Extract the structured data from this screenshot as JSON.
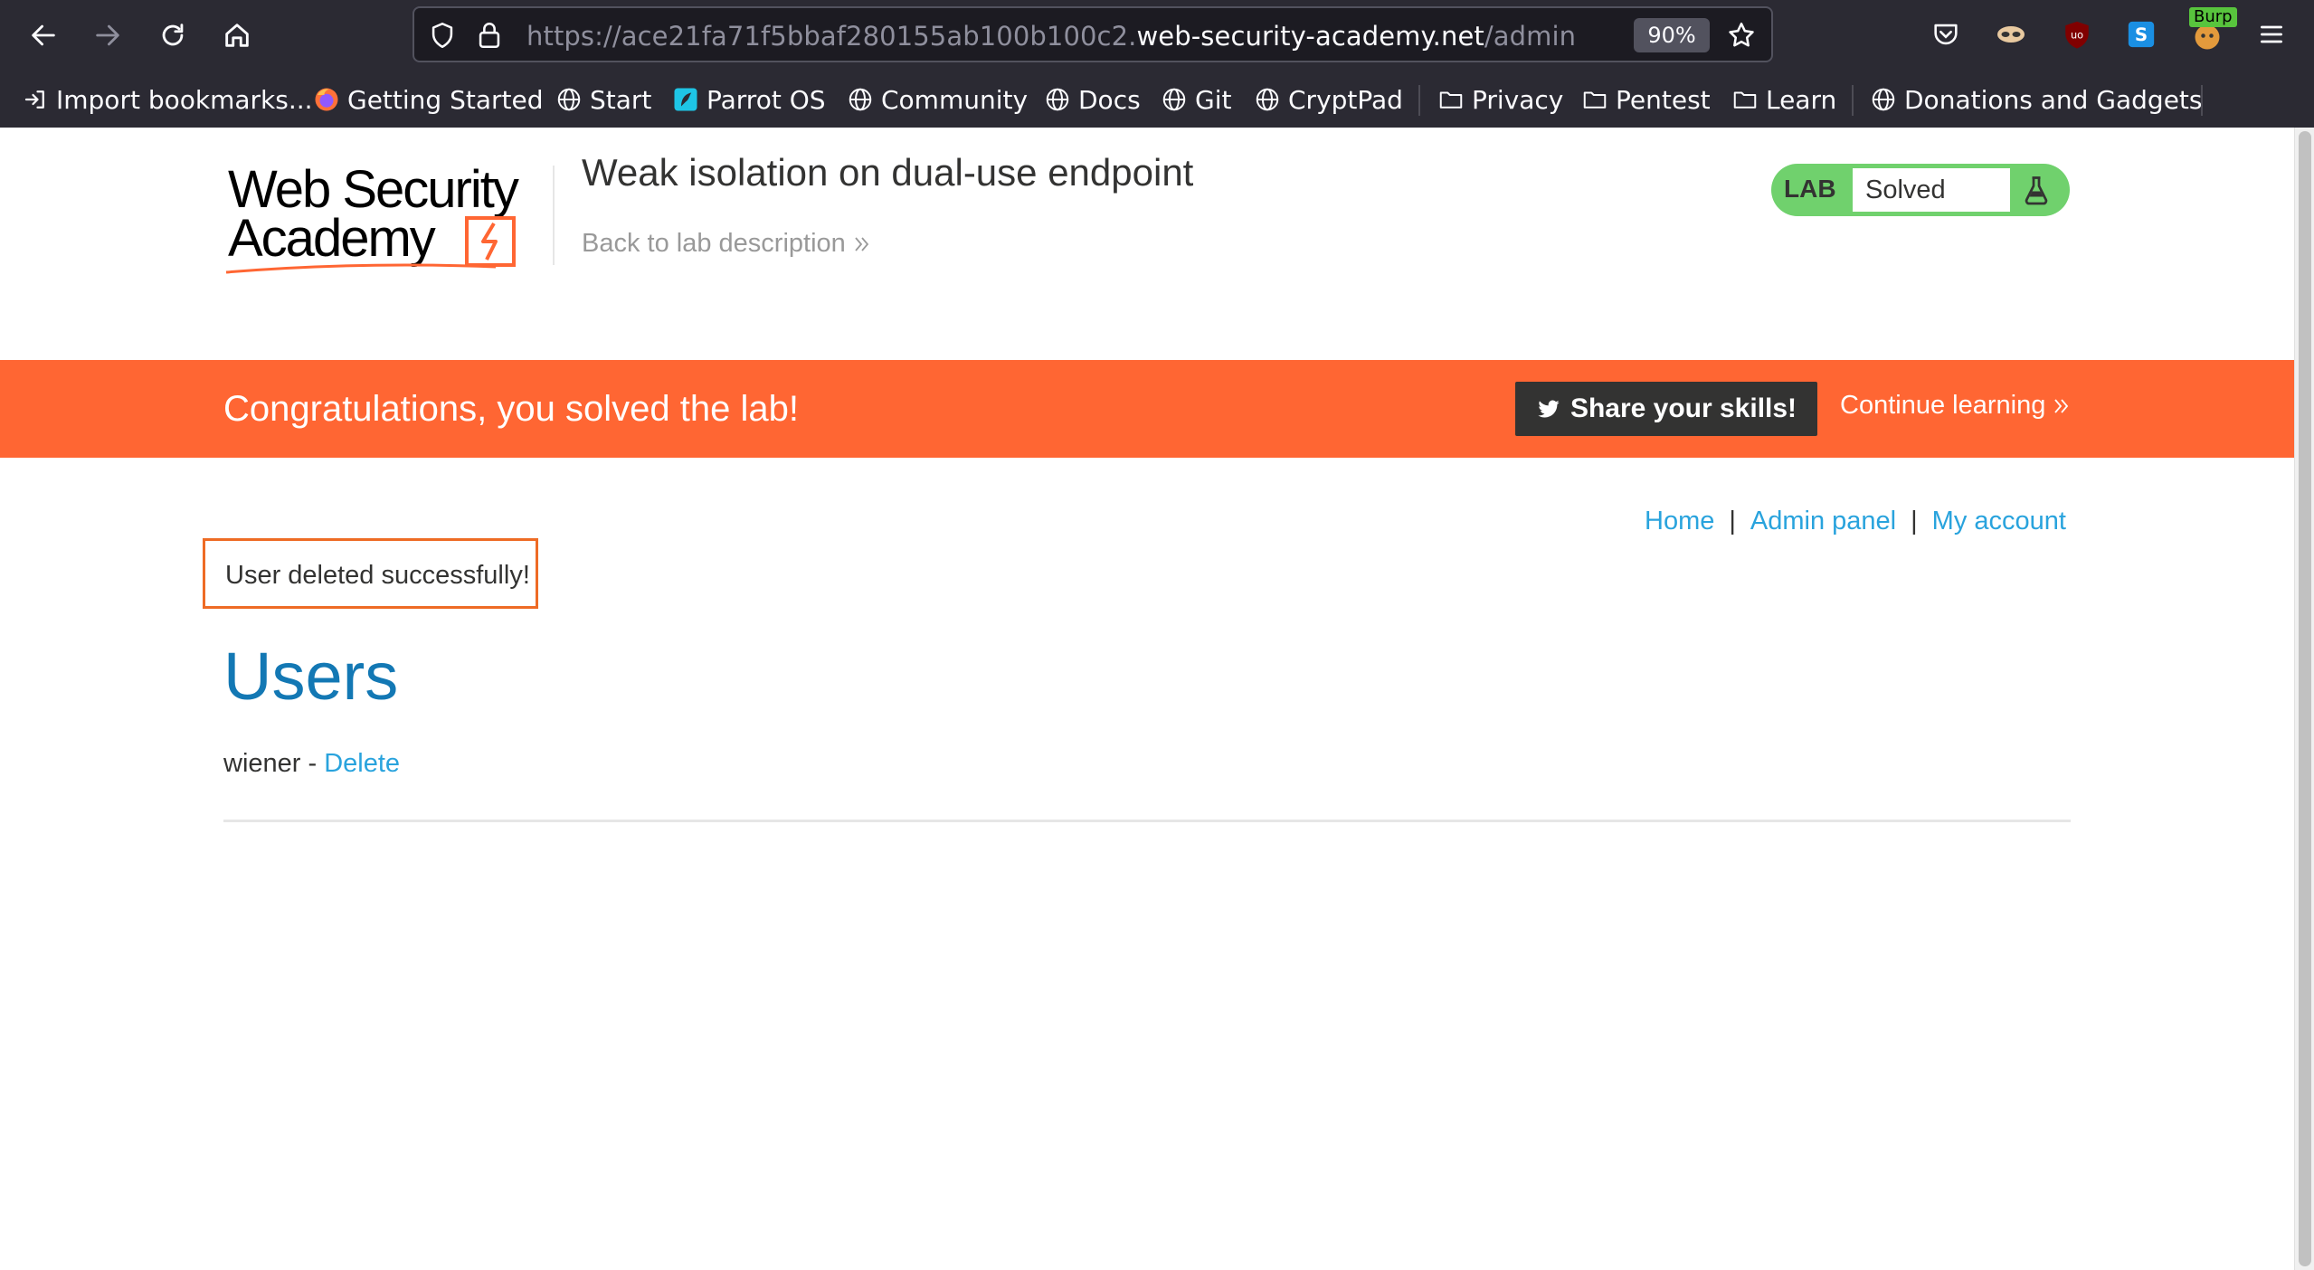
{
  "browser": {
    "url_prefix": "https://ace21fa71f5bbaf280155ab100b100c2.",
    "url_host": "web-security-academy.net",
    "url_path": "/admin",
    "zoom": "90%",
    "burp_badge": "Burp",
    "icons": {
      "back": "arrow-left-icon",
      "forward": "arrow-right-icon",
      "reload": "reload-icon",
      "home": "home-icon",
      "shield": "shield-icon",
      "lock": "lock-icon",
      "star": "star-icon",
      "pocket": "pocket-icon",
      "menu": "hamburger-menu-icon"
    }
  },
  "bookmarks": [
    {
      "label": "Import bookmarks...",
      "icon": "import-icon"
    },
    {
      "label": "Getting Started",
      "icon": "firefox-icon"
    },
    {
      "label": "Start",
      "icon": "globe-icon"
    },
    {
      "label": "Parrot OS",
      "icon": "parrot-icon"
    },
    {
      "label": "Community",
      "icon": "globe-icon"
    },
    {
      "label": "Docs",
      "icon": "globe-icon"
    },
    {
      "label": "Git",
      "icon": "globe-icon"
    },
    {
      "label": "CryptPad",
      "icon": "globe-icon"
    },
    {
      "label": "Privacy",
      "icon": "folder-icon"
    },
    {
      "label": "Pentest",
      "icon": "folder-icon"
    },
    {
      "label": "Learn",
      "icon": "folder-icon"
    },
    {
      "label": "Donations and Gadgets",
      "icon": "globe-icon"
    }
  ],
  "header": {
    "logo_line1": "Web Security",
    "logo_line2": "Academy",
    "lab_title": "Weak isolation on dual-use endpoint",
    "back_link": "Back to lab description",
    "lab_tag": "LAB",
    "lab_status": "Solved",
    "status_color": "#70d16d"
  },
  "banner": {
    "message": "Congratulations, you solved the lab!",
    "share_label": "Share your skills!",
    "continue_label": "Continue learning",
    "color": "#ff6633"
  },
  "nav": {
    "home": "Home",
    "separator": "|",
    "admin_panel": "Admin panel",
    "my_account": "My account"
  },
  "notice": "User deleted successfully!",
  "users": {
    "heading": "Users",
    "rows": [
      {
        "name": "wiener",
        "separator": " - ",
        "action": "Delete"
      }
    ]
  }
}
